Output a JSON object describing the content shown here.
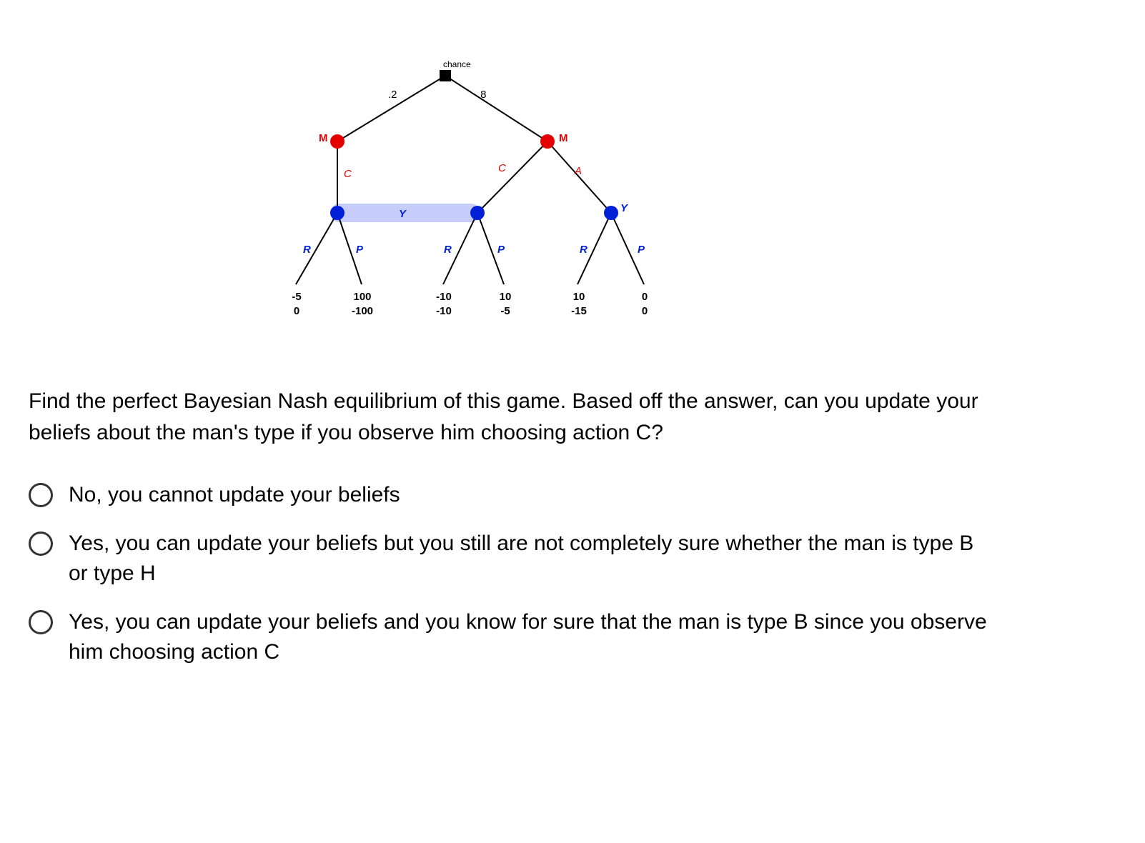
{
  "chart_data": {
    "type": "tree",
    "root": {
      "label": "chance",
      "shape": "square"
    },
    "chance_branches": [
      {
        "prob": ".2",
        "to": "M_left"
      },
      {
        "prob": ".8",
        "to": "M_right"
      }
    ],
    "M_left": {
      "player": "M",
      "actions": [
        {
          "label": "C",
          "to": "Y_left"
        }
      ]
    },
    "M_right": {
      "player": "M",
      "actions": [
        {
          "label": "C",
          "to": "Y_mid"
        },
        {
          "label": "A",
          "to": "Y_right"
        }
      ]
    },
    "information_set": [
      "Y_left",
      "Y_mid"
    ],
    "info_set_label": "Y",
    "Y_right_label": "Y",
    "Y_left": {
      "player": "Y",
      "actions": [
        "R",
        "P"
      ],
      "payoffs": {
        "R": [
          "-5",
          "0"
        ],
        "P": [
          "100",
          "-100"
        ]
      }
    },
    "Y_mid": {
      "player": "Y",
      "actions": [
        "R",
        "P"
      ],
      "payoffs": {
        "R": [
          "-10",
          "-10"
        ],
        "P": [
          "10",
          "-5"
        ]
      }
    },
    "Y_right": {
      "player": "Y",
      "actions": [
        "R",
        "P"
      ],
      "payoffs": {
        "R": [
          "10",
          "-15"
        ],
        "P": [
          "0",
          "0"
        ]
      }
    }
  },
  "labels": {
    "chance": "chance",
    "prob_left": ".2",
    "prob_right": ".8",
    "M": "M",
    "C": "C",
    "A": "A",
    "Y": "Y",
    "R": "R",
    "P": "P"
  },
  "payoffs": {
    "leaf1_a": "-5",
    "leaf1_b": "0",
    "leaf2_a": "100",
    "leaf2_b": "-100",
    "leaf3_a": "-10",
    "leaf3_b": "-10",
    "leaf4_a": "10",
    "leaf4_b": "-5",
    "leaf5_a": "10",
    "leaf5_b": "-15",
    "leaf6_a": "0",
    "leaf6_b": "0"
  },
  "question": "Find the perfect Bayesian Nash equilibrium of this game.  Based off the answer, can you update your beliefs about the man's type if you observe him choosing action C?",
  "options": [
    "No, you cannot update your beliefs",
    "Yes, you can update your beliefs but you still are not completely sure whether the man is type B or type H",
    "Yes, you can update your beliefs and you know for sure that the man is type B since you observe him choosing action C"
  ]
}
